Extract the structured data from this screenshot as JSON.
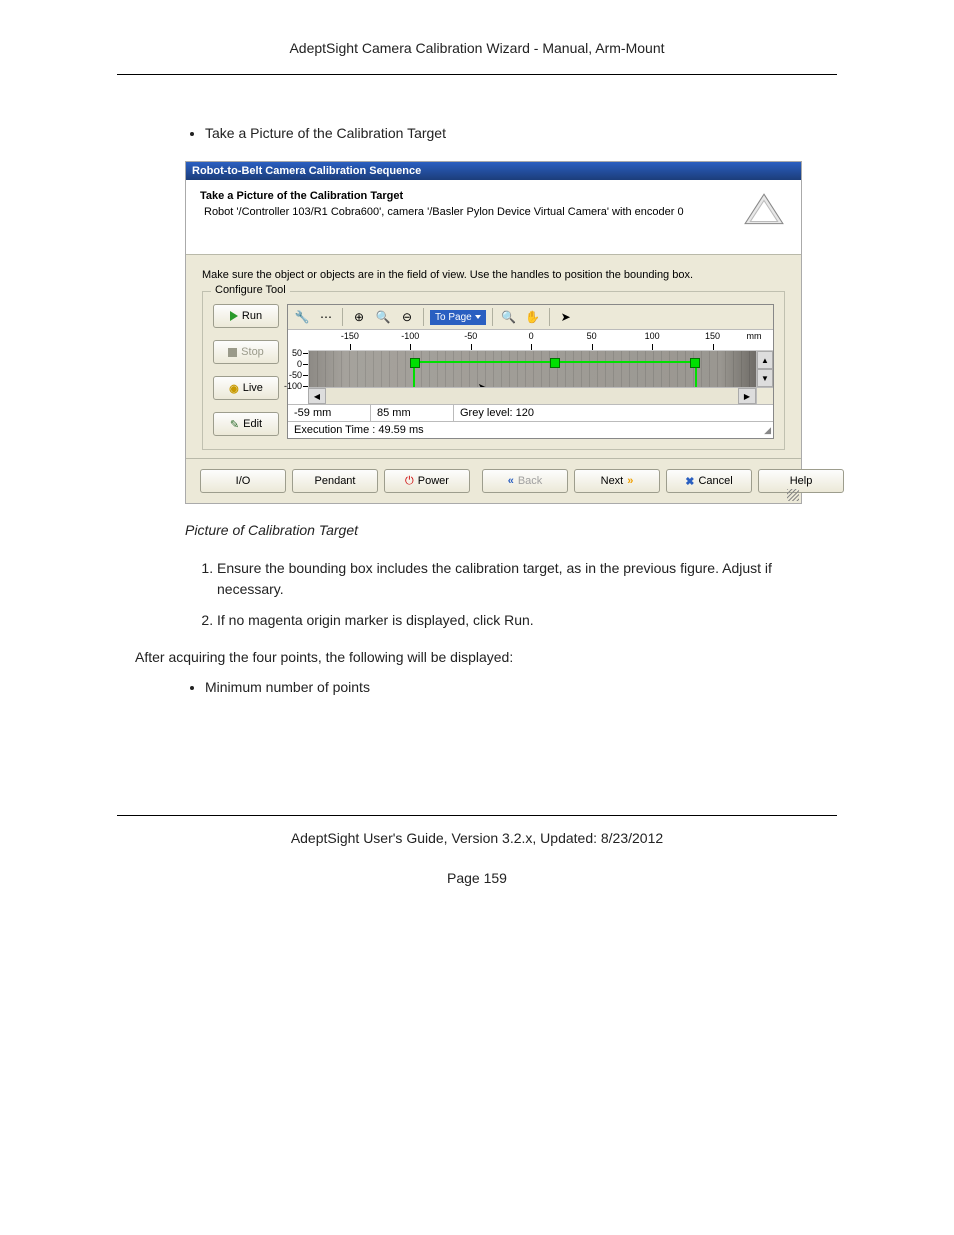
{
  "doc": {
    "header": "AdeptSight Camera Calibration Wizard - Manual, Arm-Mount",
    "bullet1": "Take a Picture of the Calibration Target",
    "caption": "Picture of Calibration Target",
    "step1": "Ensure the bounding box includes the calibration target, as in the previous figure. Adjust if necessary.",
    "step2": "If no magenta origin marker is displayed, click Run.",
    "after": "After acquiring the four points, the following will be displayed:",
    "bullet2": "Minimum number of points",
    "footer_text": "AdeptSight User's Guide,  Version 3.2.x, Updated: 8/23/2012",
    "page_num": "Page 159"
  },
  "wizard": {
    "title": "Robot-to-Belt Camera Calibration Sequence",
    "heading": "Take a Picture of the Calibration Target",
    "sub": "Robot '/Controller 103/R1 Cobra600', camera '/Basler Pylon Device Virtual Camera' with encoder 0",
    "instruction": "Make sure the object or objects are in the field of view. Use the handles to position the bounding box.",
    "fieldset_legend": "Configure Tool",
    "buttons": {
      "run": "Run",
      "stop": "Stop",
      "live": "Live",
      "edit": "Edit"
    },
    "toolbar": {
      "combo": "To Page"
    },
    "ruler_x": {
      "ticks": [
        "-150",
        "-100",
        "-50",
        "0",
        "50",
        "100",
        "150"
      ],
      "unit": "mm"
    },
    "ruler_y": {
      "ticks": [
        "50",
        "0",
        "-50",
        "-100"
      ]
    },
    "status": {
      "x": "-59 mm",
      "y": "85 mm",
      "grey": "Grey level: 120",
      "exec": "Execution Time : 49.59 ms"
    },
    "footer": {
      "io": "I/O",
      "pendant": "Pendant",
      "power": "Power",
      "back": "Back",
      "next": "Next",
      "cancel": "Cancel",
      "help": "Help"
    }
  }
}
